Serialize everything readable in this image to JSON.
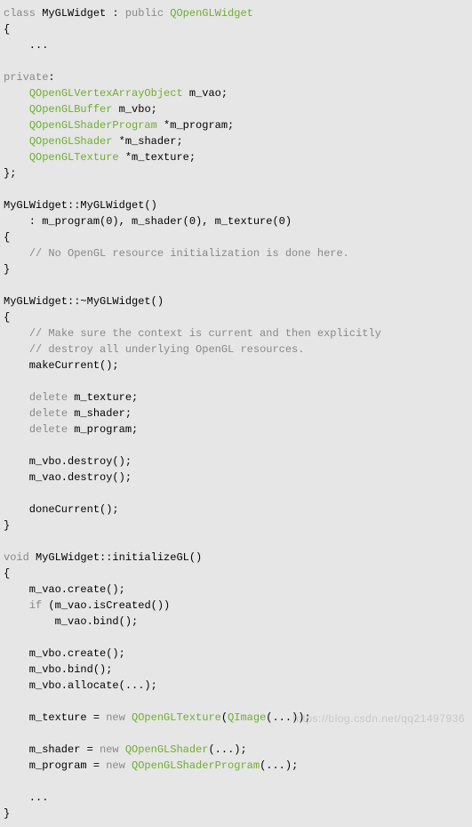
{
  "code": {
    "lines": [
      [
        {
          "t": "kw",
          "v": "class"
        },
        {
          "t": "p",
          "v": " MyGLWidget : "
        },
        {
          "t": "kw",
          "v": "public"
        },
        {
          "t": "p",
          "v": " "
        },
        {
          "t": "type",
          "v": "QOpenGLWidget"
        }
      ],
      [
        {
          "t": "p",
          "v": "{"
        }
      ],
      [
        {
          "t": "p",
          "v": "    ..."
        }
      ],
      [
        {
          "t": "p",
          "v": ""
        }
      ],
      [
        {
          "t": "kw",
          "v": "private"
        },
        {
          "t": "p",
          "v": ":"
        }
      ],
      [
        {
          "t": "p",
          "v": "    "
        },
        {
          "t": "type",
          "v": "QOpenGLVertexArrayObject"
        },
        {
          "t": "p",
          "v": " m_vao;"
        }
      ],
      [
        {
          "t": "p",
          "v": "    "
        },
        {
          "t": "type",
          "v": "QOpenGLBuffer"
        },
        {
          "t": "p",
          "v": " m_vbo;"
        }
      ],
      [
        {
          "t": "p",
          "v": "    "
        },
        {
          "t": "type",
          "v": "QOpenGLShaderProgram"
        },
        {
          "t": "p",
          "v": " *m_program;"
        }
      ],
      [
        {
          "t": "p",
          "v": "    "
        },
        {
          "t": "type",
          "v": "QOpenGLShader"
        },
        {
          "t": "p",
          "v": " *m_shader;"
        }
      ],
      [
        {
          "t": "p",
          "v": "    "
        },
        {
          "t": "type",
          "v": "QOpenGLTexture"
        },
        {
          "t": "p",
          "v": " *m_texture;"
        }
      ],
      [
        {
          "t": "p",
          "v": "};"
        }
      ],
      [
        {
          "t": "p",
          "v": ""
        }
      ],
      [
        {
          "t": "p",
          "v": "MyGLWidget::MyGLWidget()"
        }
      ],
      [
        {
          "t": "p",
          "v": "    : m_program(0), m_shader(0), m_texture(0)"
        }
      ],
      [
        {
          "t": "p",
          "v": "{"
        }
      ],
      [
        {
          "t": "p",
          "v": "    "
        },
        {
          "t": "kw",
          "v": "// No OpenGL resource initialization is done here."
        }
      ],
      [
        {
          "t": "p",
          "v": "}"
        }
      ],
      [
        {
          "t": "p",
          "v": ""
        }
      ],
      [
        {
          "t": "p",
          "v": "MyGLWidget::~MyGLWidget()"
        }
      ],
      [
        {
          "t": "p",
          "v": "{"
        }
      ],
      [
        {
          "t": "p",
          "v": "    "
        },
        {
          "t": "kw",
          "v": "// Make sure the context is current and then explicitly"
        }
      ],
      [
        {
          "t": "p",
          "v": "    "
        },
        {
          "t": "kw",
          "v": "// destroy all underlying OpenGL resources."
        }
      ],
      [
        {
          "t": "p",
          "v": "    makeCurrent();"
        }
      ],
      [
        {
          "t": "p",
          "v": ""
        }
      ],
      [
        {
          "t": "p",
          "v": "    "
        },
        {
          "t": "kw",
          "v": "delete"
        },
        {
          "t": "p",
          "v": " m_texture;"
        }
      ],
      [
        {
          "t": "p",
          "v": "    "
        },
        {
          "t": "kw",
          "v": "delete"
        },
        {
          "t": "p",
          "v": " m_shader;"
        }
      ],
      [
        {
          "t": "p",
          "v": "    "
        },
        {
          "t": "kw",
          "v": "delete"
        },
        {
          "t": "p",
          "v": " m_program;"
        }
      ],
      [
        {
          "t": "p",
          "v": ""
        }
      ],
      [
        {
          "t": "p",
          "v": "    m_vbo.destroy();"
        }
      ],
      [
        {
          "t": "p",
          "v": "    m_vao.destroy();"
        }
      ],
      [
        {
          "t": "p",
          "v": ""
        }
      ],
      [
        {
          "t": "p",
          "v": "    doneCurrent();"
        }
      ],
      [
        {
          "t": "p",
          "v": "}"
        }
      ],
      [
        {
          "t": "p",
          "v": ""
        }
      ],
      [
        {
          "t": "kw",
          "v": "void"
        },
        {
          "t": "p",
          "v": " MyGLWidget::initializeGL()"
        }
      ],
      [
        {
          "t": "p",
          "v": "{"
        }
      ],
      [
        {
          "t": "p",
          "v": "    m_vao.create();"
        }
      ],
      [
        {
          "t": "p",
          "v": "    "
        },
        {
          "t": "kw",
          "v": "if"
        },
        {
          "t": "p",
          "v": " (m_vao.isCreated())"
        }
      ],
      [
        {
          "t": "p",
          "v": "        m_vao.bind();"
        }
      ],
      [
        {
          "t": "p",
          "v": ""
        }
      ],
      [
        {
          "t": "p",
          "v": "    m_vbo.create();"
        }
      ],
      [
        {
          "t": "p",
          "v": "    m_vbo.bind();"
        }
      ],
      [
        {
          "t": "p",
          "v": "    m_vbo.allocate(...);"
        }
      ],
      [
        {
          "t": "p",
          "v": ""
        }
      ],
      [
        {
          "t": "p",
          "v": "    m_texture = "
        },
        {
          "t": "kw",
          "v": "new"
        },
        {
          "t": "p",
          "v": " "
        },
        {
          "t": "type",
          "v": "QOpenGLTexture"
        },
        {
          "t": "p",
          "v": "("
        },
        {
          "t": "type",
          "v": "QImage"
        },
        {
          "t": "p",
          "v": "(...));"
        }
      ],
      [
        {
          "t": "p",
          "v": ""
        }
      ],
      [
        {
          "t": "p",
          "v": "    m_shader = "
        },
        {
          "t": "kw",
          "v": "new"
        },
        {
          "t": "p",
          "v": " "
        },
        {
          "t": "type",
          "v": "QOpenGLShader"
        },
        {
          "t": "p",
          "v": "(...);"
        }
      ],
      [
        {
          "t": "p",
          "v": "    m_program = "
        },
        {
          "t": "kw",
          "v": "new"
        },
        {
          "t": "p",
          "v": " "
        },
        {
          "t": "type",
          "v": "QOpenGLShaderProgram"
        },
        {
          "t": "p",
          "v": "(...);"
        }
      ],
      [
        {
          "t": "p",
          "v": ""
        }
      ],
      [
        {
          "t": "p",
          "v": "    ..."
        }
      ],
      [
        {
          "t": "p",
          "v": "}"
        }
      ]
    ]
  },
  "watermark": "https://blog.csdn.net/qq21497936"
}
